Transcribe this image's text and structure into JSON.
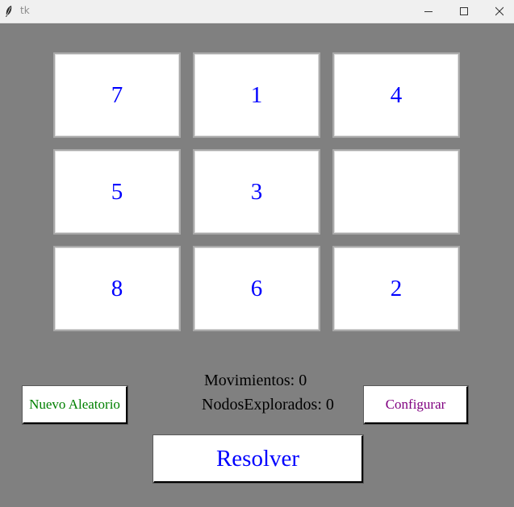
{
  "window": {
    "title": "tk",
    "controls": {
      "minimize_icon": "minimize-icon",
      "maximize_icon": "maximize-icon",
      "close_icon": "close-icon"
    }
  },
  "board": {
    "tiles": [
      {
        "label": "7"
      },
      {
        "label": "1"
      },
      {
        "label": "4"
      },
      {
        "label": "5"
      },
      {
        "label": "3"
      },
      {
        "label": ""
      },
      {
        "label": "8"
      },
      {
        "label": "6"
      },
      {
        "label": "2"
      }
    ]
  },
  "stats": {
    "moves_label": "Movimientos:",
    "moves_value": "0",
    "nodes_label": "NodosExplorados:",
    "nodes_value": "0"
  },
  "buttons": {
    "random_label": "Nuevo Aleatorio",
    "config_label": "Configurar",
    "solve_label": "Resolver"
  },
  "colors": {
    "background": "#808080",
    "tile_text": "#0000ff",
    "random_text": "#008000",
    "config_text": "#800080",
    "solve_text": "#0000ff"
  }
}
